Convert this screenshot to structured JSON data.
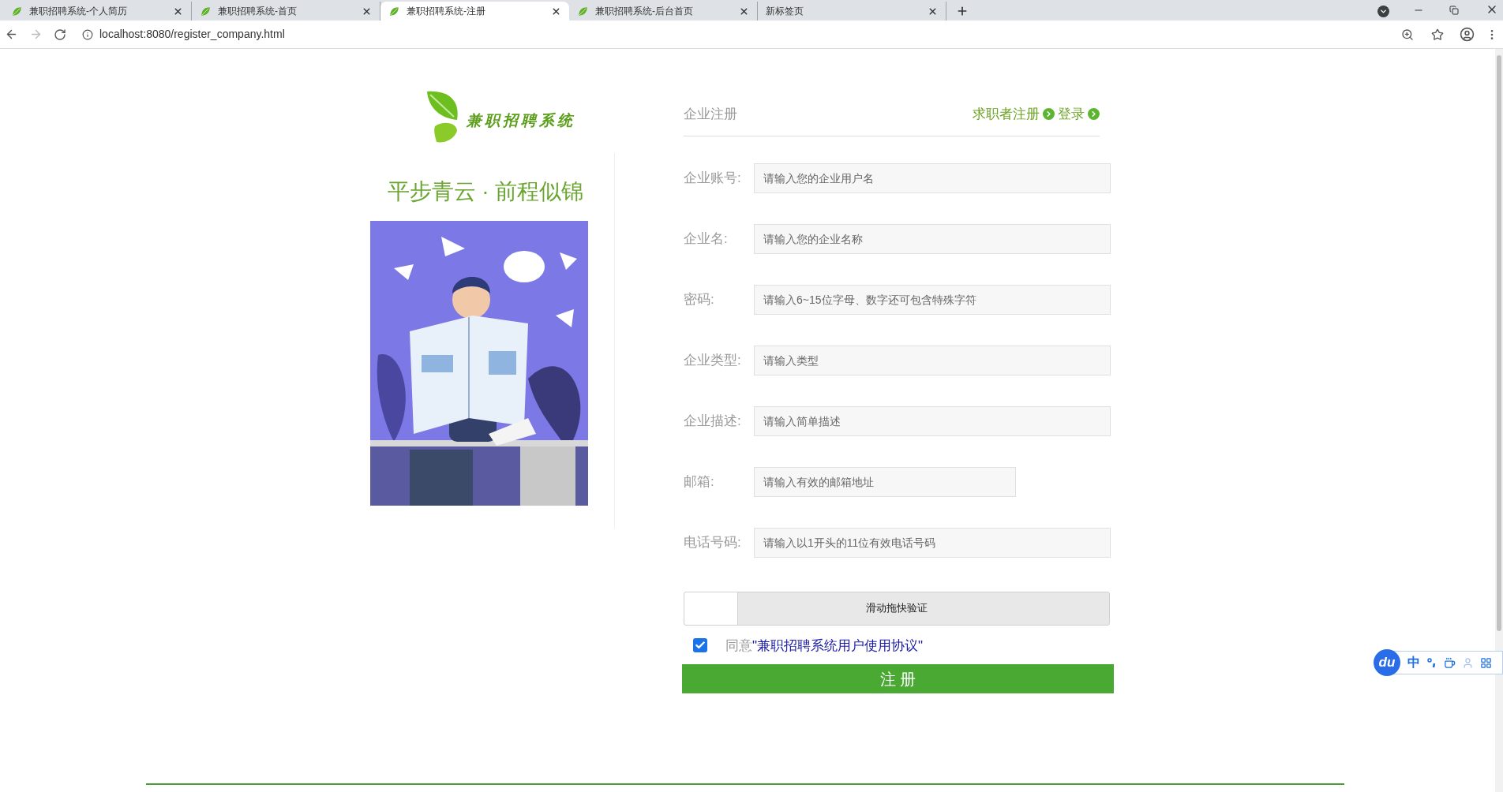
{
  "browser": {
    "tabs": [
      {
        "title": "兼职招聘系统-个人简历",
        "selected": false,
        "favicon": true
      },
      {
        "title": "兼职招聘系统-首页",
        "selected": false,
        "favicon": true
      },
      {
        "title": "兼职招聘系统-注册",
        "selected": true,
        "favicon": true
      },
      {
        "title": "兼职招聘系统-后台首页",
        "selected": false,
        "favicon": true
      },
      {
        "title": "新标签页",
        "selected": false,
        "favicon": false
      }
    ],
    "address": "localhost:8080/register_company.html"
  },
  "logo": {
    "text": "兼职招聘系统"
  },
  "slogan": "平步青云 · 前程似锦",
  "form": {
    "title": "企业注册",
    "links": [
      "求职者注册",
      "登录"
    ],
    "fields": [
      {
        "label": "企业账号:",
        "placeholder": "请输入您的企业用户名",
        "kind": "wide"
      },
      {
        "label": "企业名:",
        "placeholder": "请输入您的企业名称",
        "kind": "wide"
      },
      {
        "label": "密码:",
        "placeholder": "请输入6~15位字母、数字还可包含特殊字符",
        "kind": "wide"
      },
      {
        "label": "企业类型:",
        "placeholder": "请输入类型",
        "kind": "wide"
      },
      {
        "label": "企业描述:",
        "placeholder": "请输入简单描述",
        "kind": "wide"
      },
      {
        "label": "邮箱:",
        "placeholder": "请输入有效的邮箱地址",
        "kind": "short"
      },
      {
        "label": "电话号码:",
        "placeholder": "请输入以1开头的11位有效电话号码",
        "kind": "wide"
      }
    ],
    "slider_captcha": {
      "text": "滑动拖快验证",
      "level": 0
    },
    "agreement": {
      "checked": true,
      "prefix": "同意",
      "link": "\"兼职招聘系统用户使用协议\""
    },
    "submit": "注 册"
  },
  "ime": {
    "logo": "du",
    "mode": "中"
  }
}
